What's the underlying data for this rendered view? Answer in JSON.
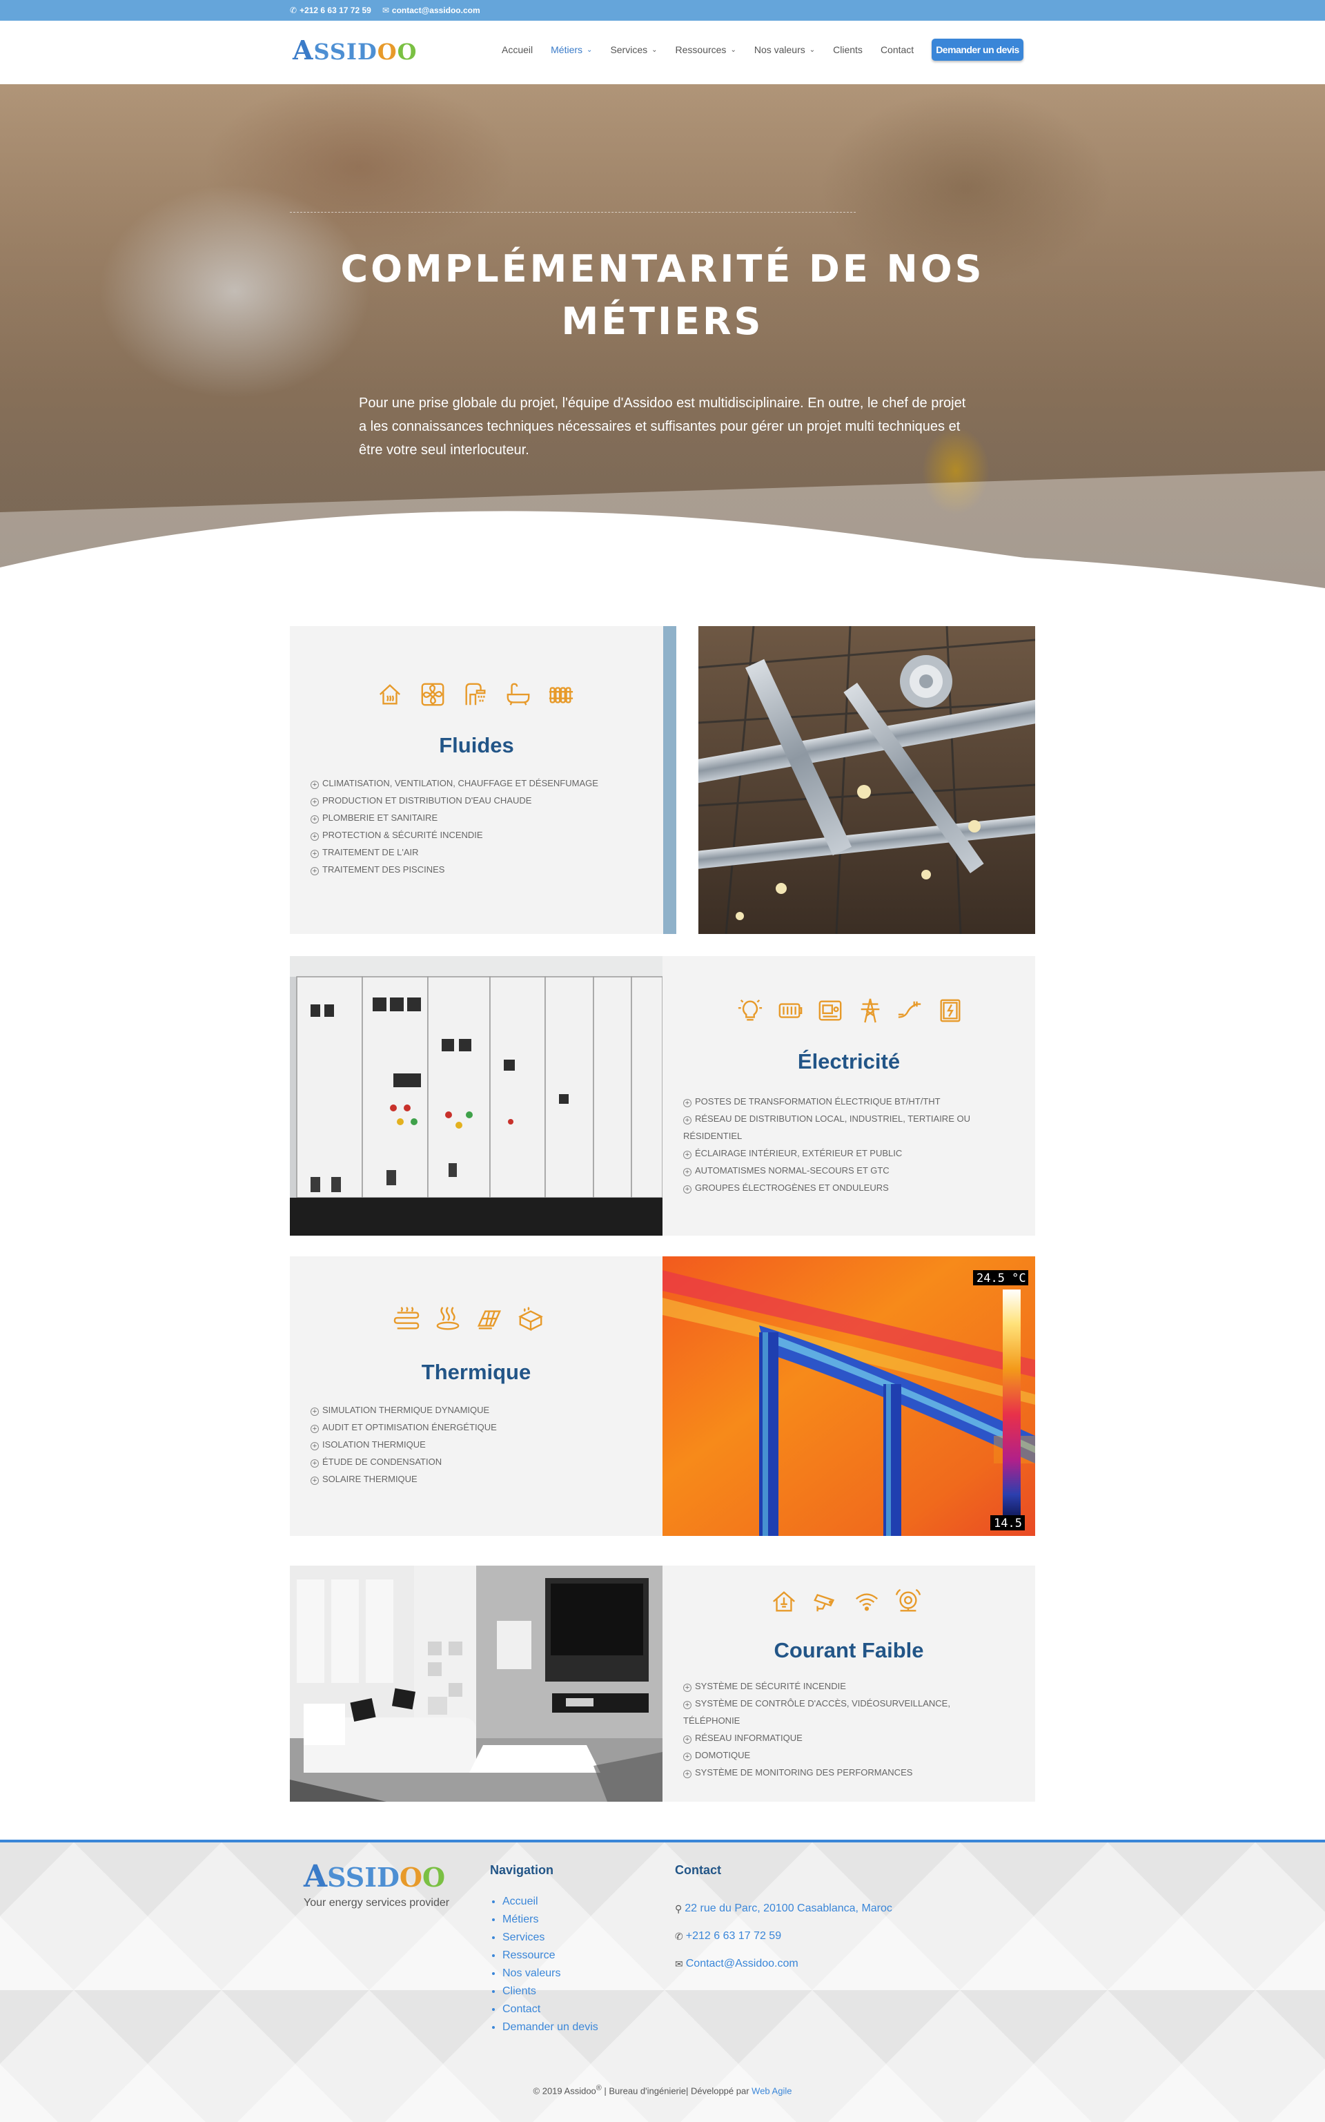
{
  "topbar": {
    "phone": "+212 6 63 17 72 59",
    "email": "contact@assidoo.com"
  },
  "header": {
    "logo": "ASSIDOO",
    "nav": [
      {
        "label": "Accueil",
        "has_caret": false,
        "active": false
      },
      {
        "label": "Métiers",
        "has_caret": true,
        "active": true
      },
      {
        "label": "Services",
        "has_caret": true,
        "active": false
      },
      {
        "label": "Ressources",
        "has_caret": true,
        "active": false
      },
      {
        "label": "Nos valeurs",
        "has_caret": true,
        "active": false
      },
      {
        "label": "Clients",
        "has_caret": false,
        "active": false
      },
      {
        "label": "Contact",
        "has_caret": false,
        "active": false
      }
    ],
    "cta": "Demander un devis"
  },
  "hero": {
    "title_line1": "COMPLÉMENTARITÉ DE NOS",
    "title_line2": "MÉTIERS",
    "text": "Pour une prise globale du projet, l'équipe d'Assidoo est multidisciplinaire. En outre, le chef de projet a les connaissances techniques nécessaires et suffisantes pour gérer un projet multi techniques et être votre seul interlocuteur."
  },
  "services": [
    {
      "title": "Fluides",
      "icons": [
        "house-heating-icon",
        "fan-icon",
        "shower-icon",
        "bathtub-icon",
        "radiator-icon"
      ],
      "items": [
        "Climatisation, ventilation, chauffage et désenfumage",
        "Production et distribution d'eau chaude",
        "Plomberie et sanitaire",
        "Protection & sécurité incendie",
        "Traitement de l'air",
        "Traitement des piscines"
      ]
    },
    {
      "title": "Électricité",
      "icons": [
        "lightbulb-icon",
        "battery-icon",
        "meter-icon",
        "power-pylon-icon",
        "cable-icon",
        "electrical-panel-icon"
      ],
      "items": [
        "Postes de transformation électrique BT/HT/THT",
        "Réseau de distribution local, industriel, tertiaire ou résidentiel",
        "Éclairage intérieur, extérieur et public",
        "Automatismes normal-secours et GTC",
        "Groupes électrogènes et onduleurs"
      ]
    },
    {
      "title": "Thermique",
      "icons": [
        "heat-coil-icon",
        "heat-plate-icon",
        "solar-panel-icon",
        "thermal-insulation-icon"
      ],
      "items": [
        "Simulation thermique dynamique",
        "Audit et optimisation énergétique",
        "Isolation thermique",
        "Étude de condensation",
        "Solaire thermique"
      ]
    },
    {
      "title": "Courant Faible",
      "icons": [
        "smart-home-icon",
        "security-camera-icon",
        "wifi-icon",
        "alarm-bell-icon"
      ],
      "items": [
        "Système de sécurité incendie",
        "Système de contrôle d'accès, vidéosurveillance, téléphonie",
        "Réseau informatique",
        "Domotique",
        "Système de monitoring des performances"
      ]
    }
  ],
  "thermal_scale": {
    "max": "24.5 °C",
    "min": "14.5"
  },
  "footer": {
    "logo": "ASSIDOO",
    "tagline": "Your energy services provider",
    "nav_title": "Navigation",
    "nav_links": [
      "Accueil",
      "Métiers",
      "Services",
      "Ressource",
      "Nos valeurs",
      "Clients",
      "Contact",
      "Demander un devis"
    ],
    "contact_title": "Contact",
    "address": "22 rue du Parc, 20100 Casablanca, Maroc",
    "phone": "+212 6 63 17 72 59",
    "email": "Contact@Assidoo.com",
    "copyright": "© 2019 Assidoo",
    "copyright_mark": "®",
    "copyright_rest": " | Bureau d'ingénierie| Développé par ",
    "developer": "Web Agile"
  },
  "colors": {
    "topbar": "#65a5da",
    "accent": "#3a86d8",
    "title_blue": "#225587",
    "icon_orange": "#e79a2a",
    "panel_bg": "#f3f3f3"
  }
}
